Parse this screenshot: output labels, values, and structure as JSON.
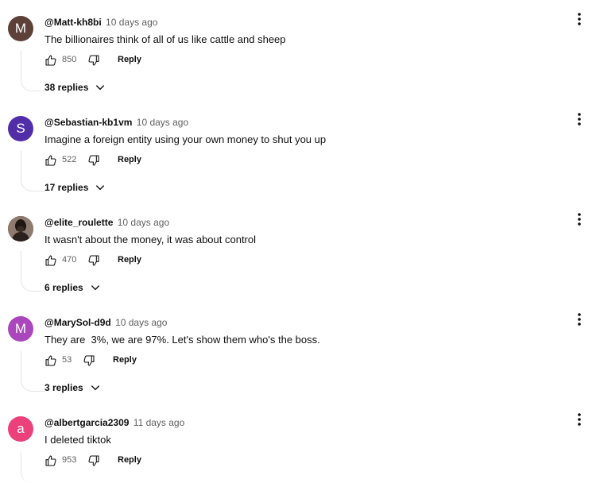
{
  "comments": [
    {
      "author": "@Matt-kh8bi",
      "time": "10 days ago",
      "text": "The billionaires think of all of us like cattle and sheep",
      "likes": "850",
      "reply_label": "Reply",
      "replies_label": "38 replies",
      "avatar_letter": "M",
      "avatar_color": "#5d4037"
    },
    {
      "author": "@Sebastian-kb1vm",
      "time": "10 days ago",
      "text": "Imagine a foreign entity using your own money to shut you up",
      "likes": "522",
      "reply_label": "Reply",
      "replies_label": "17 replies",
      "avatar_letter": "S",
      "avatar_color": "#512da8"
    },
    {
      "author": "@elite_roulette",
      "time": "10 days ago",
      "text": "It wasn't about the money, it was about control",
      "likes": "470",
      "reply_label": "Reply",
      "replies_label": "6 replies",
      "avatar_letter": "",
      "avatar_color": "#3e342e"
    },
    {
      "author": "@MarySol-d9d",
      "time": "10 days ago",
      "text": "They are  3%, we are 97%. Let's show them who's the boss.",
      "likes": "53",
      "reply_label": "Reply",
      "replies_label": "3 replies",
      "avatar_letter": "M",
      "avatar_color": "#ab47bc"
    },
    {
      "author": "@albertgarcia2309",
      "time": "11 days ago",
      "text": "I deleted tiktok",
      "likes": "953",
      "reply_label": "Reply",
      "replies_label": "",
      "avatar_letter": "a",
      "avatar_color": "#ec407a"
    }
  ]
}
